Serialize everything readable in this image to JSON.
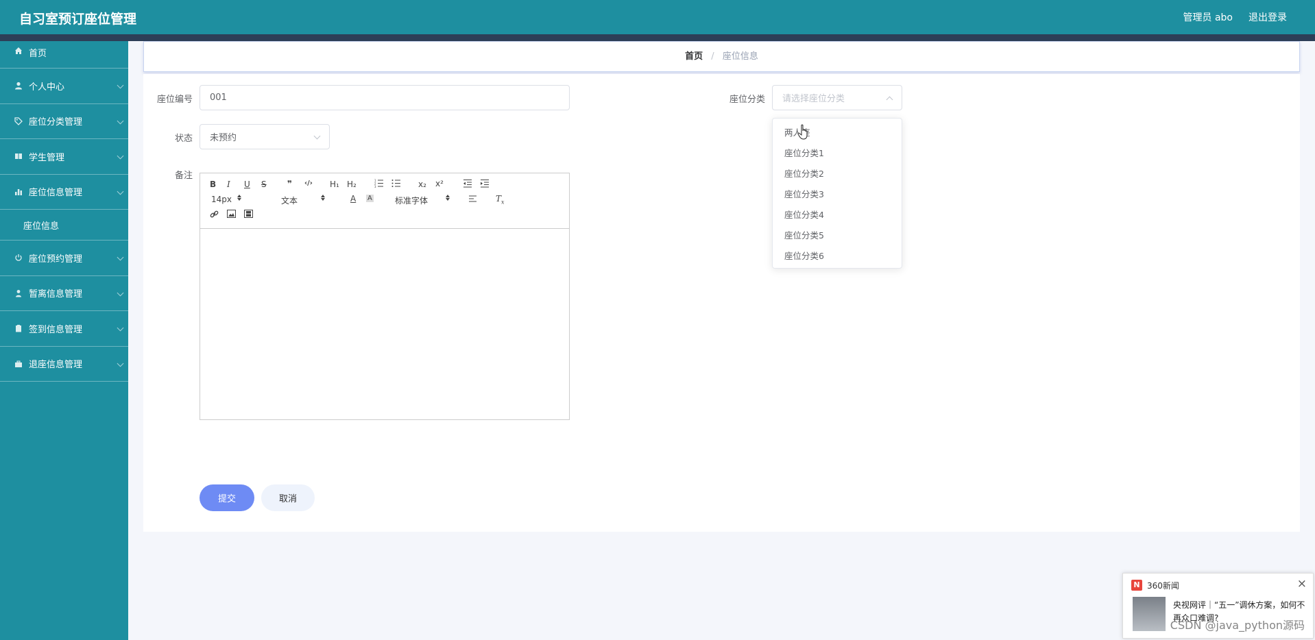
{
  "app": {
    "title": "自习室预订座位管理"
  },
  "header": {
    "admin_label": "管理员 abo",
    "logout_label": "退出登录"
  },
  "sidebar": {
    "items": [
      {
        "label": "首页",
        "icon": "home-icon"
      },
      {
        "label": "个人中心",
        "icon": "user-icon"
      },
      {
        "label": "座位分类管理",
        "icon": "tag-icon"
      },
      {
        "label": "学生管理",
        "icon": "book-icon"
      },
      {
        "label": "座位信息管理",
        "icon": "chart-icon"
      },
      {
        "label": "座位信息",
        "icon": ""
      },
      {
        "label": "座位预约管理",
        "icon": "power-icon"
      },
      {
        "label": "暂离信息管理",
        "icon": "person-icon"
      },
      {
        "label": "签到信息管理",
        "icon": "clipboard-icon"
      },
      {
        "label": "退座信息管理",
        "icon": "briefcase-icon"
      }
    ]
  },
  "breadcrumb": {
    "home": "首页",
    "separator": "/",
    "current": "座位信息"
  },
  "form": {
    "seat_no_label": "座位编号",
    "seat_no_value": "001",
    "category_label": "座位分类",
    "category_placeholder": "请选择座位分类",
    "status_label": "状态",
    "status_value": "未预约",
    "remark_label": "备注",
    "submit_label": "提交",
    "cancel_label": "取消"
  },
  "editor": {
    "font_size": "14px",
    "text_type": "文本",
    "font_family": "标准字体",
    "buttons": [
      "B",
      "I",
      "U",
      "S",
      "❞",
      "‹/›",
      "H₁",
      "H₂",
      "x₂",
      "x²"
    ]
  },
  "dropdown": {
    "options": [
      "两人座",
      "座位分类1",
      "座位分类2",
      "座位分类3",
      "座位分类4",
      "座位分类5",
      "座位分类6"
    ]
  },
  "news": {
    "source": "360新闻",
    "logo": "N",
    "close": "×",
    "headline": "央视网评｜“五一”调休方案，如何不再众口难调?"
  },
  "watermark": "CSDN @java_python源码",
  "colors": {
    "primary": "#1e8fa0",
    "accent": "#6e8bf4",
    "strip": "#2d3e57"
  }
}
